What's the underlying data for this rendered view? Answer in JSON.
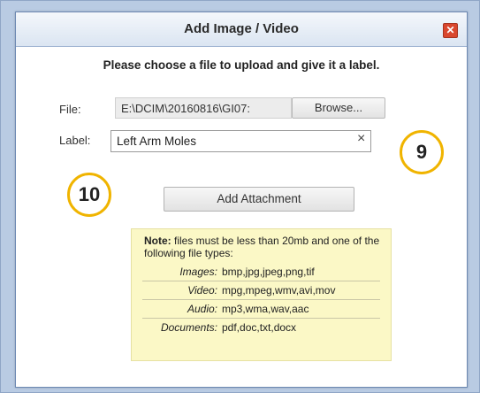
{
  "dialog": {
    "title": "Add Image / Video",
    "close_glyph": "✕",
    "instructions": "Please choose a file to upload and give it a label."
  },
  "form": {
    "file_label": "File:",
    "file_value": "E:\\DCIM\\20160816\\GI07:",
    "browse_label": "Browse...",
    "label_label": "Label:",
    "label_value": "Left Arm Moles",
    "clear_glyph": "×",
    "add_button_label": "Add Attachment"
  },
  "callouts": {
    "badge_9": "9",
    "badge_10": "10",
    "accent_color": "#f0b400"
  },
  "note": {
    "prefix": "Note:",
    "text": " files must be less than 20mb and one of the following file types:",
    "file_types": [
      {
        "name": "Images:",
        "values": "bmp,jpg,jpeg,png,tif"
      },
      {
        "name": "Video:",
        "values": "mpg,mpeg,wmv,avi,mov"
      },
      {
        "name": "Audio:",
        "values": "mp3,wma,wav,aac"
      },
      {
        "name": "Documents:",
        "values": "pdf,doc,txt,docx"
      }
    ]
  },
  "icons": {
    "close": "close-icon",
    "clear": "clear-icon"
  }
}
